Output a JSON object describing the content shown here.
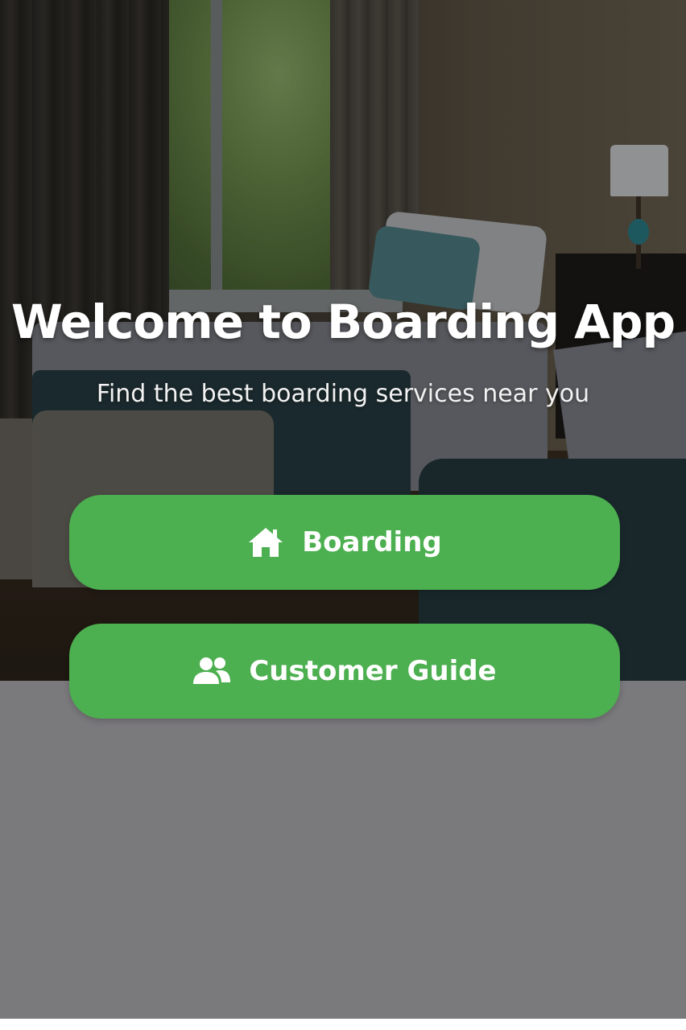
{
  "hero": {
    "title": "Welcome to Boarding App",
    "subtitle": "Find the best boarding services near you",
    "image": "bedroom-photo"
  },
  "actions": [
    {
      "label": "Boarding",
      "icon": "home-icon"
    },
    {
      "label": "Customer Guide",
      "icon": "users-icon"
    }
  ],
  "colors": {
    "button_green": "#4caf50",
    "page_background": "#7a797c",
    "text": "#ffffff"
  }
}
